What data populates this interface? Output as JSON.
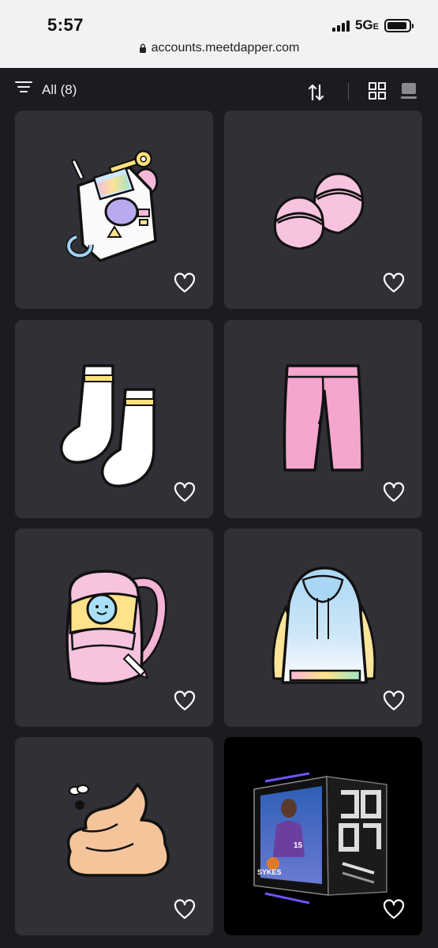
{
  "status": {
    "time": "5:57",
    "network": "5G",
    "network_suffix": "E",
    "battery_level": 0.92
  },
  "browser": {
    "url": "accounts.meetdapper.com"
  },
  "toolbar": {
    "filter_label": "All (8)"
  },
  "items": [
    {
      "name": "walkie-talkie-key-icon",
      "favorited": false
    },
    {
      "name": "pink-slippers-icon",
      "favorited": false
    },
    {
      "name": "white-socks-icon",
      "favorited": false
    },
    {
      "name": "pink-pants-icon",
      "favorited": false
    },
    {
      "name": "pink-backpack-icon",
      "favorited": false
    },
    {
      "name": "pastel-hoodie-icon",
      "favorited": false
    },
    {
      "name": "poop-fly-icon",
      "favorited": false
    },
    {
      "name": "basketball-card-cube-icon",
      "player_label": "SYKES",
      "favorited": false
    }
  ],
  "colors": {
    "background": "#1c1b20",
    "card": "#313036",
    "text": "#f0f0f2"
  }
}
